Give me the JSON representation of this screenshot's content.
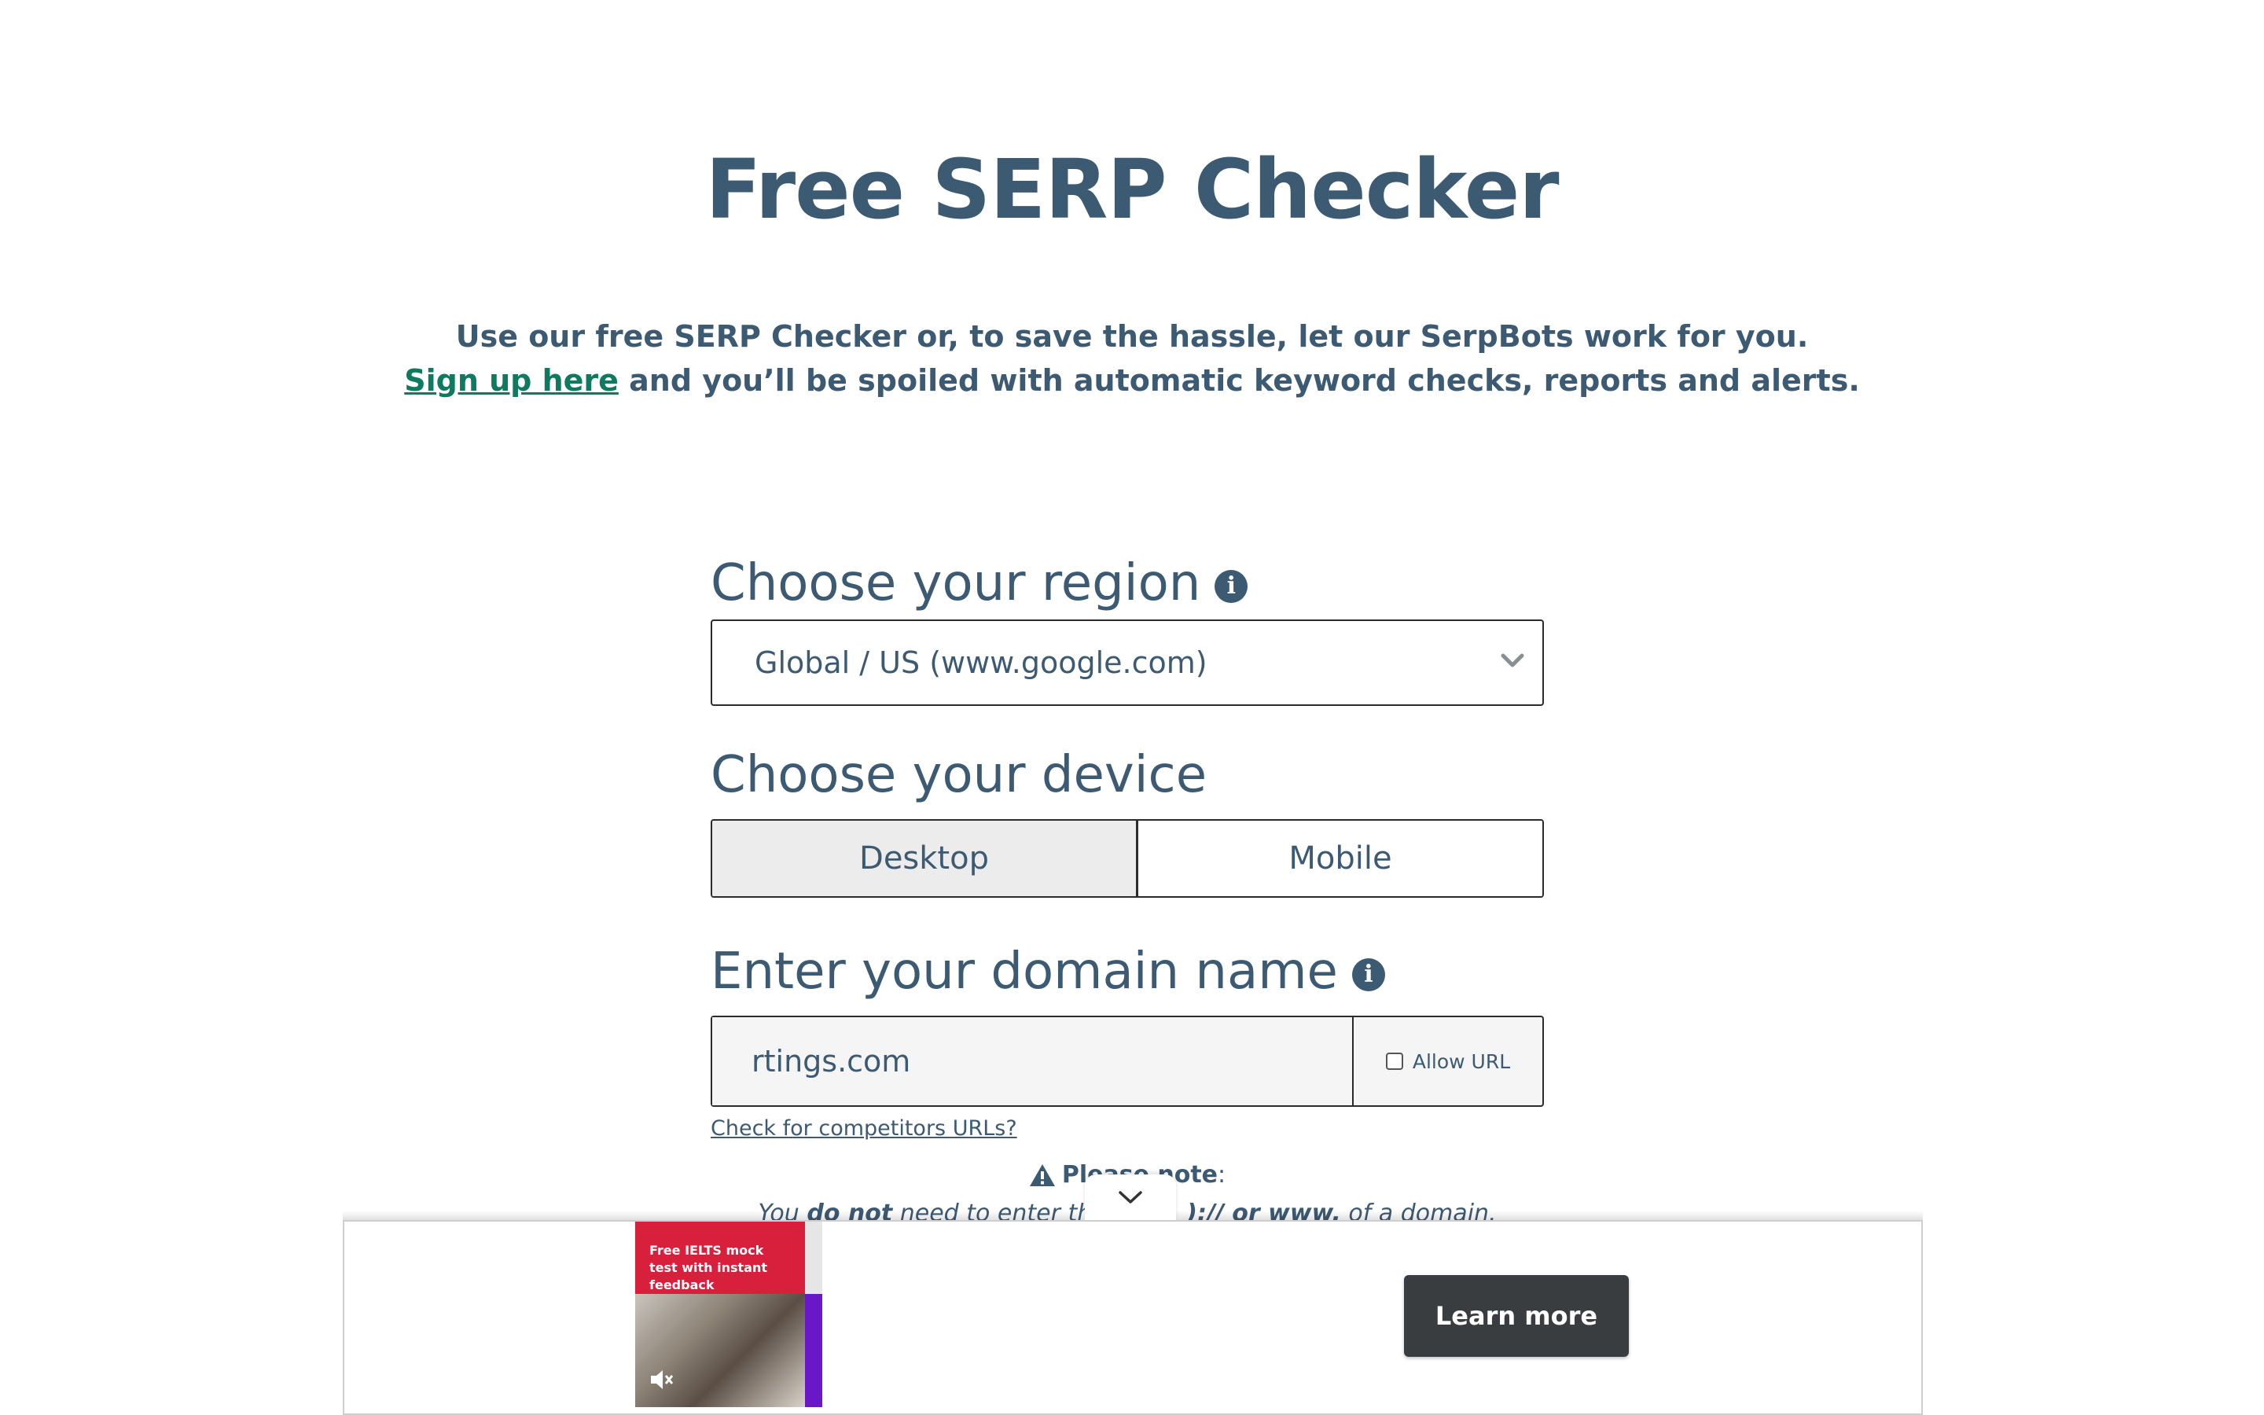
{
  "page": {
    "title": "Free SERP Checker",
    "intro_line1": "Use our free SERP Checker or, to save the hassle, let our SerpBots work for you.",
    "signup_link": "Sign up here",
    "intro_line2_rest": " and you’ll be spoiled with automatic keyword checks, reports and alerts."
  },
  "region": {
    "label": "Choose your region",
    "selected": "Global / US (www.google.com)"
  },
  "device": {
    "label": "Choose your device",
    "options": [
      "Desktop",
      "Mobile"
    ],
    "selected": "Desktop"
  },
  "domain": {
    "label": "Enter your domain name",
    "value": "rtings.com",
    "allow_url_label": "Allow URL",
    "allow_url_checked": false,
    "competitors_link": "Check for competitors URLs?"
  },
  "note": {
    "heading": "Please note",
    "colon": ":",
    "text_part1": "You ",
    "text_bold1": "do not",
    "text_part2": " need to enter th",
    "text_hidden_tail": "):// or ",
    "text_bold2": "www.",
    "text_part3": " of a domain."
  },
  "ad": {
    "headline": "Free IELTS mock test with instant feedback",
    "cta": "Learn more",
    "accent_red": "#d81f3c",
    "accent_purple": "#6a17c9"
  },
  "colors": {
    "primary_text": "#3d5a73",
    "link_green": "#0e7a5f"
  }
}
